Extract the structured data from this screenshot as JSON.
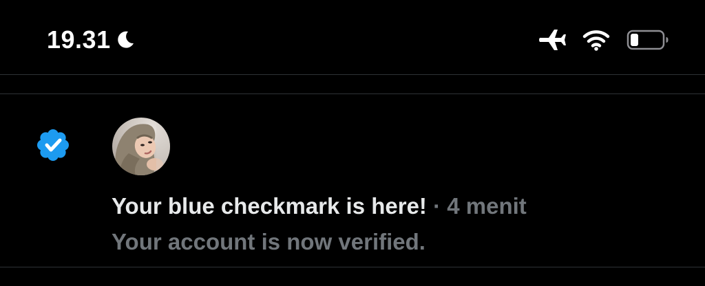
{
  "status_bar": {
    "time": "19.31",
    "icons": [
      "moon-icon",
      "airplane-mode-icon",
      "wifi-icon",
      "battery-icon"
    ],
    "battery_level": 0.25
  },
  "notification": {
    "icon": "verified-badge-icon",
    "title": "Your blue checkmark is here!",
    "separator": "·",
    "time": "4 menit",
    "body": "Your account is now verified."
  },
  "colors": {
    "background": "#000000",
    "primary_text": "#e7e9ea",
    "secondary_text": "#71767b",
    "divider": "#2f3336",
    "verified_blue": "#1d9bf0"
  }
}
